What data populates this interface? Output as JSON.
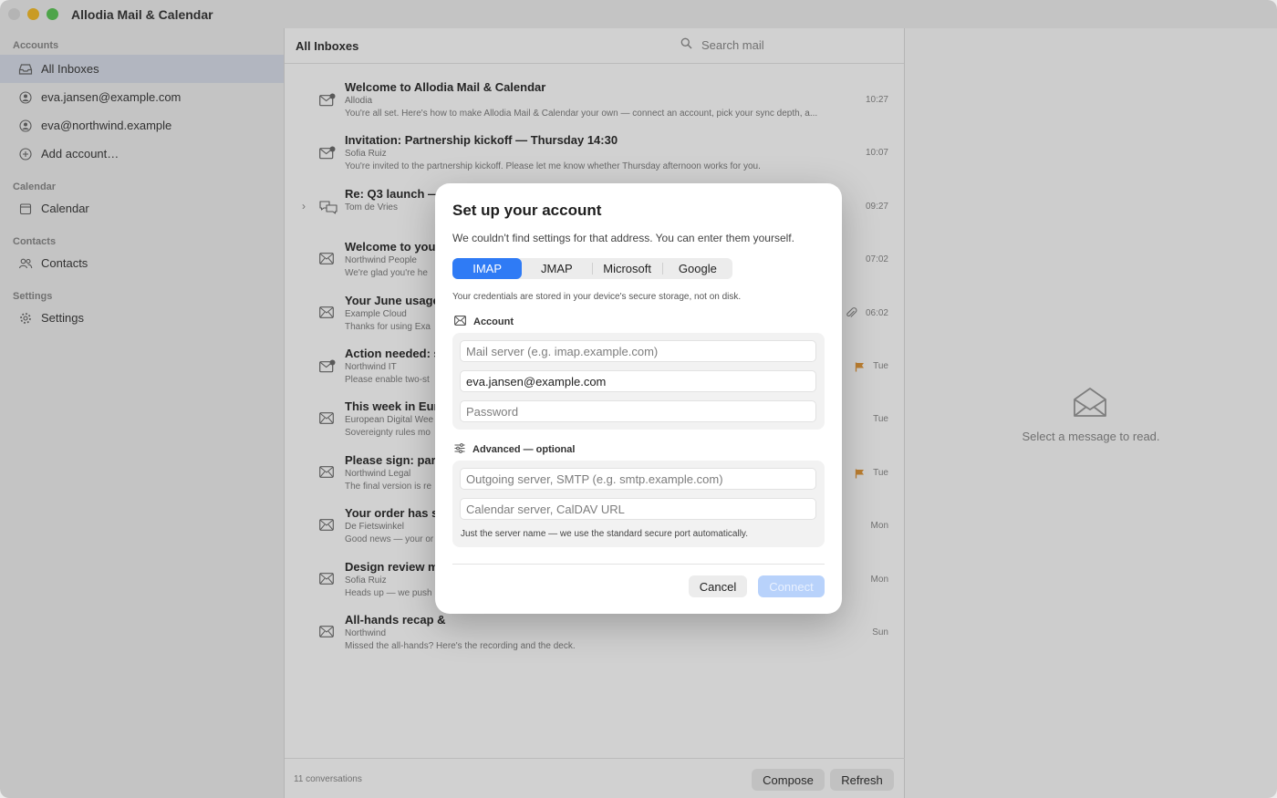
{
  "app": {
    "title": "Allodia Mail & Calendar"
  },
  "sidebar": {
    "accounts_label": "Accounts",
    "accounts": [
      {
        "label": "All Inboxes",
        "icon": "inbox-icon",
        "selected": true
      },
      {
        "label": "eva.jansen@example.com",
        "icon": "person-icon"
      },
      {
        "label": "eva@northwind.example",
        "icon": "person-icon"
      },
      {
        "label": "Add account…",
        "icon": "plus-circle-icon"
      }
    ],
    "calendar_label": "Calendar",
    "calendar_item": "Calendar",
    "contacts_label": "Contacts",
    "contacts_item": "Contacts",
    "settings_label": "Settings",
    "settings_item": "Settings"
  },
  "list": {
    "title": "All Inboxes",
    "search_placeholder": "Search mail",
    "messages": [
      {
        "subject": "Welcome to Allodia Mail & Calendar",
        "from": "Allodia",
        "preview": "You're all set. Here's how to make Allodia Mail & Calendar your own — connect an account, pick your sync depth, a...",
        "time": "10:27",
        "icon": "mail-badge-icon"
      },
      {
        "subject": "Invitation: Partnership kickoff — Thursday 14:30",
        "from": "Sofia Ruiz",
        "preview": "You're invited to the partnership kickoff. Please let me know whether Thursday afternoon works for you.",
        "time": "10:07",
        "icon": "mail-badge-icon"
      },
      {
        "subject": "Re: Q3 launch —",
        "from": "Tom de Vries",
        "preview": "",
        "time": "09:27",
        "icon": "chat-bubbles-icon",
        "thread": true
      },
      {
        "subject": "Welcome to your",
        "from": "Northwind People",
        "preview": "We're glad you're he",
        "time": "07:02",
        "icon": "envelope-icon"
      },
      {
        "subject": "Your June usage",
        "from": "Example Cloud",
        "preview": "Thanks for using Exa",
        "time": "06:02",
        "icon": "envelope-icon",
        "attachment": true
      },
      {
        "subject": "Action needed: s",
        "from": "Northwind IT",
        "preview": "Please enable two-st",
        "time": "Tue",
        "icon": "mail-badge-icon",
        "flagged": true
      },
      {
        "subject": "This week in Euro",
        "from": "European Digital Wee",
        "preview": "Sovereignty rules mo",
        "time": "Tue",
        "icon": "envelope-icon"
      },
      {
        "subject": "Please sign: part",
        "from": "Northwind Legal",
        "preview": "The final version is re",
        "time": "Tue",
        "icon": "envelope-icon",
        "flagged": true
      },
      {
        "subject": "Your order has sh",
        "from": "De Fietswinkel",
        "preview": "Good news — your or",
        "time": "Mon",
        "icon": "envelope-icon"
      },
      {
        "subject": "Design review m",
        "from": "Sofia Ruiz",
        "preview": "Heads up — we push",
        "time": "Mon",
        "icon": "envelope-icon"
      },
      {
        "subject": "All-hands recap &",
        "from": "Northwind",
        "preview": "Missed the all-hands? Here's the recording and the deck.",
        "time": "Sun",
        "icon": "envelope-icon"
      }
    ],
    "count": "11 conversations",
    "compose_label": "Compose",
    "refresh_label": "Refresh"
  },
  "reading": {
    "empty_text": "Select a message to read."
  },
  "dialog": {
    "title": "Set up your account",
    "subtitle": "We couldn't find settings for that address. You can enter them yourself.",
    "tabs": [
      "IMAP",
      "JMAP",
      "Microsoft",
      "Google"
    ],
    "active_tab": "IMAP",
    "storage_note": "Your credentials are stored in your device's secure storage, not on disk.",
    "account_label": "Account",
    "mail_server_placeholder": "Mail server (e.g. imap.example.com)",
    "email_value": "eva.jansen@example.com",
    "password_placeholder": "Password",
    "advanced_label": "Advanced — optional",
    "smtp_placeholder": "Outgoing server, SMTP (e.g. smtp.example.com)",
    "caldav_placeholder": "Calendar server, CalDAV URL",
    "advanced_note": "Just the server name — we use the standard secure port automatically.",
    "cancel_label": "Cancel",
    "connect_label": "Connect"
  },
  "colors": {
    "accent": "#2f7bf5",
    "connect_disabled": "#b8d2fb",
    "flag": "#e59a3c"
  }
}
